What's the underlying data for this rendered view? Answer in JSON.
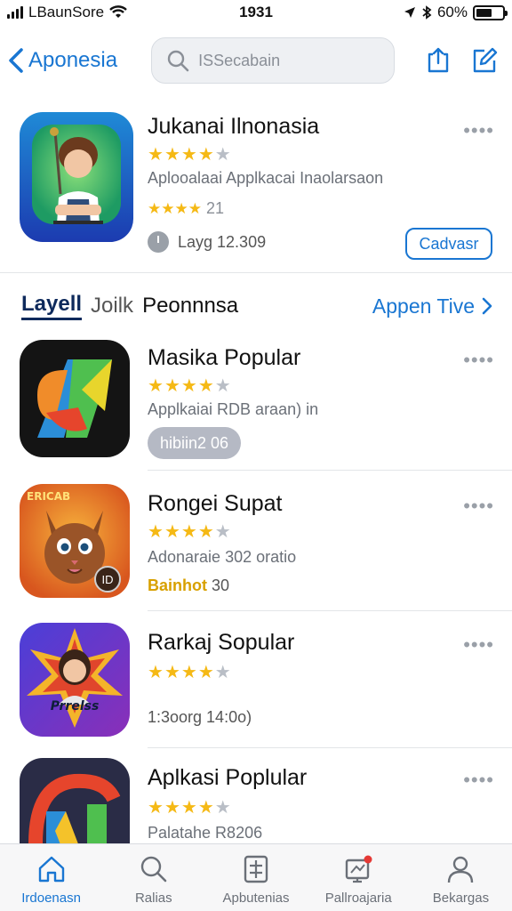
{
  "status_bar": {
    "carrier": "LBaunSore",
    "time": "1931",
    "battery": "60%",
    "battery_level": 0.6
  },
  "nav": {
    "back_label": "Aponesia",
    "search_placeholder": "ISSecabain"
  },
  "featured": {
    "title": "Jukanai Ilnonasia",
    "rating_stars": 4,
    "description": "Aplooalaai Applkacai Inaolarsaon",
    "secondary_rating_text": "★★★★ 21",
    "time_text": "Layg 12.309",
    "action_label": "Cadvasr",
    "more_label": "••••"
  },
  "section": {
    "tab1": "Layell",
    "tab2": "Joilk",
    "tab3": "Peonnnsa",
    "see_all": "Appen Tive"
  },
  "apps": [
    {
      "title": "Masika Popular",
      "rating_stars": 4,
      "subtitle": "Applkaiai RDB araan) in",
      "pill": "hibiin2 06",
      "more_label": "••••"
    },
    {
      "title": "Rongei Supat",
      "rating_stars": 4,
      "subtitle": "Adonaraie 302 oratio",
      "highlight": "Bainhot",
      "highlight_suffix": "30",
      "badge": "ID",
      "icon_text": "ERICAB",
      "more_label": "••••"
    },
    {
      "title": "Rarkaj Sopular",
      "rating_stars": 4,
      "subtitle": "1:3oorg 14:0o)",
      "icon_text": "Prrelss",
      "more_label": "••••"
    },
    {
      "title": "Aplkasi Poplular",
      "rating_stars": 4,
      "subtitle": "Palatahe R8206",
      "more_label": "••••"
    }
  ],
  "tabs": [
    {
      "label": "Irdoenasn",
      "icon": "home-icon",
      "active": true
    },
    {
      "label": "Ralias",
      "icon": "search-icon",
      "active": false
    },
    {
      "label": "Apbutenias",
      "icon": "apps-icon",
      "active": false
    },
    {
      "label": "Pallroajaria",
      "icon": "notification-icon",
      "active": false
    },
    {
      "label": "Bekargas",
      "icon": "profile-icon",
      "active": false
    }
  ],
  "colors": {
    "accent": "#1976d2",
    "star": "#f5b915",
    "star_off": "#b9bec6"
  }
}
